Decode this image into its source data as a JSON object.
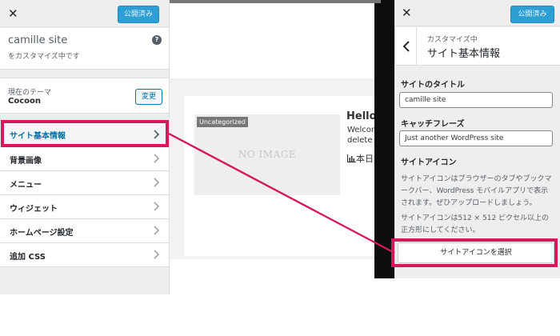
{
  "left_panel": {
    "close_icon": "✕",
    "publish_label": "公開済み",
    "site_name": "camille site",
    "site_sub": "をカスタマイズ中です",
    "help_icon": "?",
    "theme_label": "現在のテーマ",
    "theme_name": "Cocoon",
    "change_label": "変更",
    "menu": [
      {
        "label": "サイト基本情報"
      },
      {
        "label": "背景画像"
      },
      {
        "label": "メニュー"
      },
      {
        "label": "ウィジェット"
      },
      {
        "label": "ホームページ設定"
      },
      {
        "label": "追加 CSS"
      }
    ]
  },
  "preview": {
    "category_badge": "Uncategorized",
    "noimage_text": "NO IMAGE",
    "post_title": "Hello",
    "post_line1": "Welcon",
    "post_line2": "delete",
    "post_meta": "本日"
  },
  "right_panel": {
    "close_icon": "✕",
    "publish_label": "公開済み",
    "breadcrumb": "カスタマイズ中",
    "title": "サイト基本情報",
    "site_title_label": "サイトのタイトル",
    "site_title_value": "camille site",
    "tagline_label": "キャッチフレーズ",
    "tagline_value": "Just another WordPress site",
    "site_icon_label": "サイトアイコン",
    "site_icon_desc1": "サイトアイコンはブラウザーのタブやブックマークバー、WordPress モバイルアプリで表示されます。ぜひアップロードしましょう。",
    "site_icon_desc2": "サイトアイコンは512 × 512 ピクセル以上の正方形にしてください。",
    "select_icon_label": "サイトアイコンを選択"
  },
  "colors": {
    "highlight": "#d6195c",
    "accent_blue": "#0073aa",
    "publish_bg": "#2e9fd4"
  },
  "icons": {
    "close": "close-icon",
    "help": "help-icon",
    "chevron": "chevron-right-icon",
    "back": "chevron-left-icon",
    "chart": "bar-chart-icon"
  }
}
